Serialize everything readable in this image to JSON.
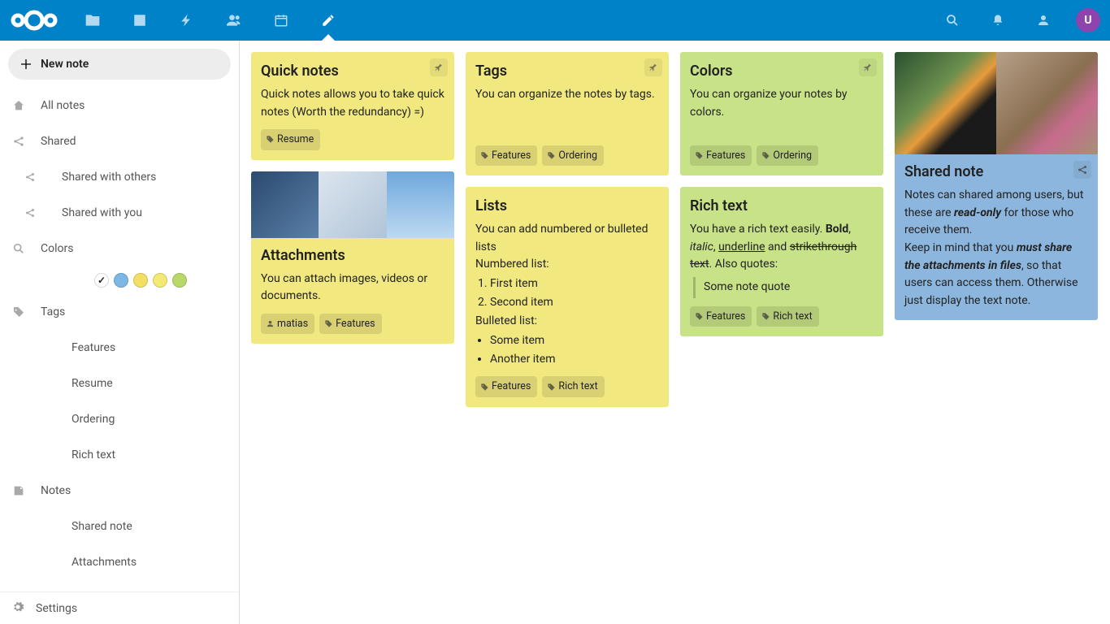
{
  "avatar_letter": "U",
  "sidebar": {
    "new_note": "New note",
    "all_notes": "All notes",
    "shared": "Shared",
    "shared_with_others": "Shared with others",
    "shared_with_you": "Shared with you",
    "colors": "Colors",
    "color_swatches": [
      {
        "hex": "#ffffff",
        "selected": true
      },
      {
        "hex": "#7db7e4",
        "selected": false
      },
      {
        "hex": "#f2df63",
        "selected": false
      },
      {
        "hex": "#f4e974",
        "selected": false
      },
      {
        "hex": "#b8d96a",
        "selected": false
      }
    ],
    "tags": "Tags",
    "tag_items": [
      "Features",
      "Resume",
      "Ordering",
      "Rich text"
    ],
    "notes": "Notes",
    "note_items": [
      "Shared note",
      "Attachments"
    ],
    "settings": "Settings"
  },
  "cards": {
    "quick_notes": {
      "title": "Quick notes",
      "body": "Quick notes allows you to take quick notes (Worth the redundancy) =)",
      "chips": [
        "Resume"
      ]
    },
    "tags": {
      "title": "Tags",
      "body": "You can organize the notes by tags.",
      "chips": [
        "Features",
        "Ordering"
      ]
    },
    "colors": {
      "title": "Colors",
      "body": "You can organize your notes by colors.",
      "chips": [
        "Features",
        "Ordering"
      ]
    },
    "shared_note": {
      "title": "Shared note",
      "body_pre": "Notes can shared among users, but these are ",
      "body_ro": "read-only",
      "body_post": " for those who receive them.",
      "body2_pre": "Keep in mind that you ",
      "body2_em": "must share the attachments in files",
      "body2_post": ", so that users can access them. Otherwise just display the text note."
    },
    "attachments": {
      "title": "Attachments",
      "body": "You can attach images, videos or documents.",
      "user_chip": "matias",
      "chips": [
        "Features"
      ]
    },
    "lists": {
      "title": "Lists",
      "body": "You can add numbered or bulleted lists",
      "numbered_label": "Numbered list:",
      "numbered": [
        "First item",
        "Second item"
      ],
      "bulleted_label": "Bulleted list:",
      "bulleted": [
        "Some item",
        "Another item"
      ],
      "chips": [
        "Features",
        "Rich text"
      ]
    },
    "rich_text": {
      "title": "Rich text",
      "body_pre": "You have a rich text easily.  ",
      "bold": "Bold",
      "sep1": ", ",
      "italic": "italic",
      "sep2": ", ",
      "underline": "underline",
      "sep3": " and ",
      "strike": "strikethrough text",
      "body_post": ". Also quotes:",
      "quote": "Some note quote",
      "chips": [
        "Features",
        "Rich text"
      ]
    }
  }
}
